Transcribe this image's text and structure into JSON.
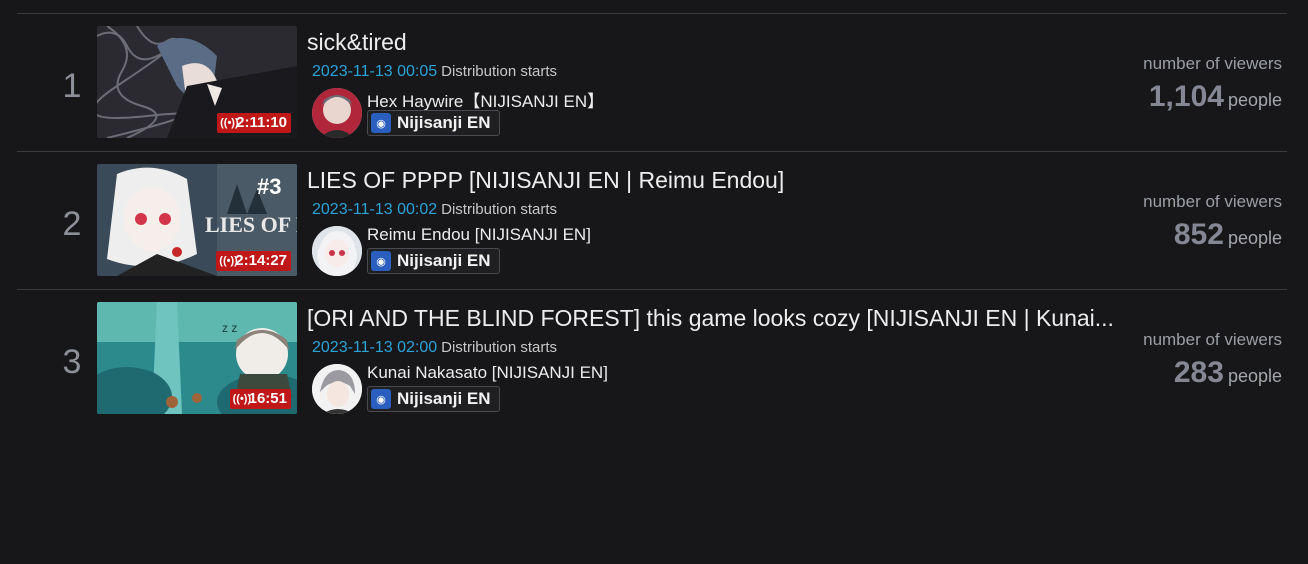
{
  "streams": [
    {
      "rank": "1",
      "duration": "2:11:10",
      "title": "sick&tired",
      "date": "2023-11-13 00:05",
      "dist_label": "Distribution starts",
      "channel": "Hex Haywire【NIJISANJI EN】",
      "org": "Nijisanji EN",
      "viewers_label": "number of viewers",
      "viewers": "1,104",
      "unit": "people"
    },
    {
      "rank": "2",
      "duration": "2:14:27",
      "title": "LIES OF PPPP [NIJISANJI EN | Reimu Endou]",
      "date": "2023-11-13 00:02",
      "dist_label": "Distribution starts",
      "channel": "Reimu Endou [NIJISANJI EN]",
      "org": "Nijisanji EN",
      "viewers_label": "number of viewers",
      "viewers": "852",
      "unit": "people"
    },
    {
      "rank": "3",
      "duration": "16:51",
      "title": "[ORI AND THE BLIND FOREST] this game looks cozy [NIJISANJI EN | Kunai...",
      "date": "2023-11-13 02:00",
      "dist_label": "Distribution starts",
      "channel": "Kunai Nakasato [NIJISANJI EN]",
      "org": "Nijisanji EN",
      "viewers_label": "number of viewers",
      "viewers": "283",
      "unit": "people"
    }
  ],
  "thumb_texts": {
    "lies_number": "#3",
    "lies_title": "LIES OF P"
  },
  "colors": {
    "background": "#171719",
    "date": "#2aa3d8",
    "live_badge": "#c01818",
    "divider": "#3a3b40"
  }
}
